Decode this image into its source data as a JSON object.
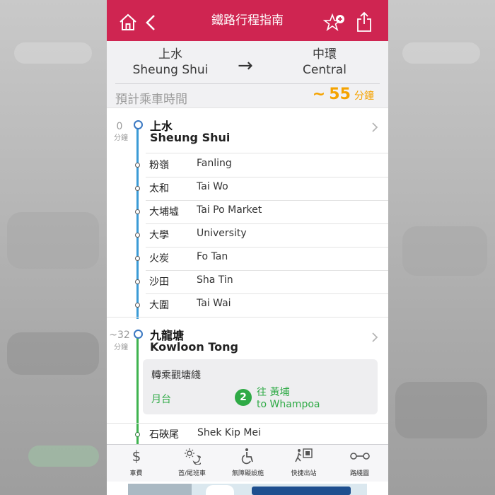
{
  "header": {
    "title": "鐵路行程指南",
    "home_icon": "home-icon",
    "back_icon": "back-chevron-icon",
    "favorite_icon": "star-add-icon",
    "share_icon": "share-icon"
  },
  "route": {
    "from_zh": "上水",
    "from_en": "Sheung Shui",
    "to_zh": "中環",
    "to_en": "Central",
    "arrow": "→",
    "estimated_label": "預計乘車時間",
    "estimated_prefix": "~",
    "estimated_value": "55",
    "estimated_unit": "分鐘"
  },
  "stops": {
    "origin": {
      "time": "0",
      "unit": "分鐘",
      "zh": "上水",
      "en": "Sheung Shui"
    },
    "intermediate": [
      {
        "zh": "粉嶺",
        "en": "Fanling"
      },
      {
        "zh": "太和",
        "en": "Tai Wo"
      },
      {
        "zh": "大埔墟",
        "en": "Tai Po Market"
      },
      {
        "zh": "大學",
        "en": "University"
      },
      {
        "zh": "火炭",
        "en": "Fo Tan"
      },
      {
        "zh": "沙田",
        "en": "Sha Tin"
      },
      {
        "zh": "大圍",
        "en": "Tai Wai"
      }
    ],
    "interchange": {
      "time": "~32",
      "unit": "分鐘",
      "zh": "九龍塘",
      "en": "Kowloon Tong"
    },
    "after": [
      {
        "zh": "石硤尾",
        "en": "Shek Kip Mei"
      }
    ]
  },
  "interchange_box": {
    "title": "轉乘觀塘綫",
    "platform_label": "月台",
    "platform_number": "2",
    "direction_zh": "往 黃埔",
    "direction_en": "to Whampoa"
  },
  "tabs": [
    {
      "label": "車費",
      "icon": "dollar-icon"
    },
    {
      "label": "首/尾班車",
      "icon": "first-last-train-icon"
    },
    {
      "label": "無障礙設施",
      "icon": "wheelchair-icon"
    },
    {
      "label": "快捷出站",
      "icon": "quick-exit-icon"
    },
    {
      "label": "路綫圖",
      "icon": "route-map-icon"
    }
  ],
  "colors": {
    "header": "#cf2551",
    "east_rail_line": "#3b9bd6",
    "kwun_tong_line": "#3fb34f",
    "estimate": "#f5a300"
  }
}
